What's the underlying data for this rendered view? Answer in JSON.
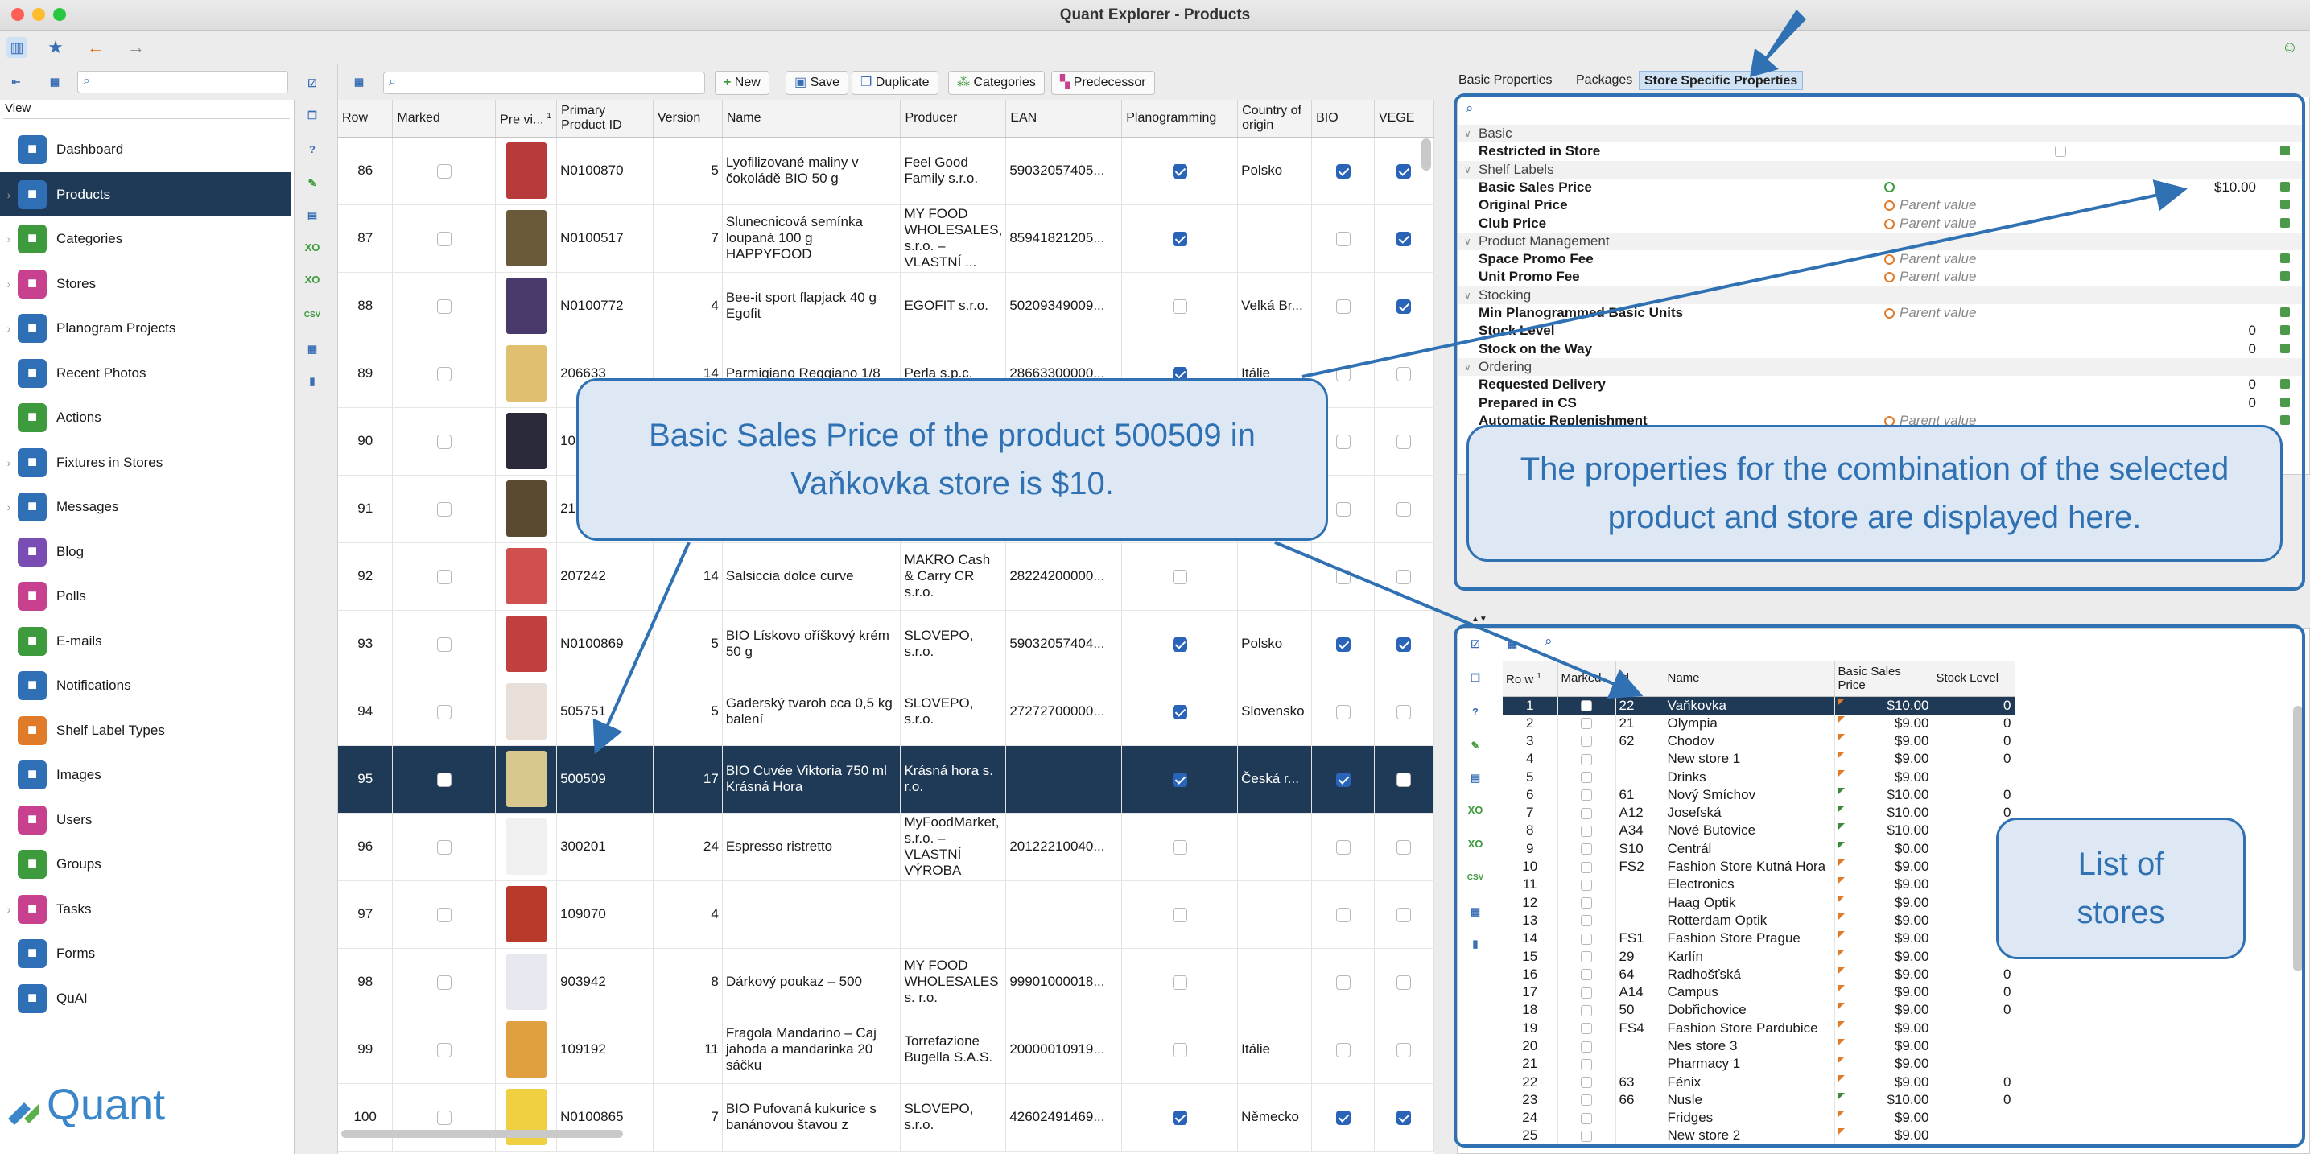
{
  "window": {
    "title": "Quant Explorer - Products"
  },
  "sidebar": {
    "view_label": "View",
    "items": [
      {
        "label": "Dashboard",
        "icon": "dashboard-icon",
        "color": "#2f6fb5",
        "chev": ""
      },
      {
        "label": "Products",
        "icon": "products-icon",
        "color": "#2f6fb5",
        "chev": "›"
      },
      {
        "label": "Categories",
        "icon": "categories-icon",
        "color": "#3d9a3d",
        "chev": "›"
      },
      {
        "label": "Stores",
        "icon": "stores-icon",
        "color": "#c8418e",
        "chev": "›"
      },
      {
        "label": "Planogram Projects",
        "icon": "planogram-icon",
        "color": "#2f6fb5",
        "chev": "›"
      },
      {
        "label": "Recent Photos",
        "icon": "photos-icon",
        "color": "#2f6fb5",
        "chev": ""
      },
      {
        "label": "Actions",
        "icon": "actions-icon",
        "color": "#3d9a3d",
        "chev": ""
      },
      {
        "label": "Fixtures in Stores",
        "icon": "fixtures-icon",
        "color": "#2f6fb5",
        "chev": "›"
      },
      {
        "label": "Messages",
        "icon": "messages-icon",
        "color": "#2f6fb5",
        "chev": "›"
      },
      {
        "label": "Blog",
        "icon": "blog-icon",
        "color": "#7a4db5",
        "chev": ""
      },
      {
        "label": "Polls",
        "icon": "polls-icon",
        "color": "#c8418e",
        "chev": ""
      },
      {
        "label": "E-mails",
        "icon": "emails-icon",
        "color": "#3d9a3d",
        "chev": ""
      },
      {
        "label": "Notifications",
        "icon": "notifications-icon",
        "color": "#2f6fb5",
        "chev": ""
      },
      {
        "label": "Shelf Label Types",
        "icon": "shelf-label-icon",
        "color": "#e07b2a",
        "chev": ""
      },
      {
        "label": "Images",
        "icon": "images-icon",
        "color": "#2f6fb5",
        "chev": ""
      },
      {
        "label": "Users",
        "icon": "users-icon",
        "color": "#c8418e",
        "chev": ""
      },
      {
        "label": "Groups",
        "icon": "groups-icon",
        "color": "#3d9a3d",
        "chev": ""
      },
      {
        "label": "Tasks",
        "icon": "tasks-icon",
        "color": "#c8418e",
        "chev": "›"
      },
      {
        "label": "Forms",
        "icon": "forms-icon",
        "color": "#2f6fb5",
        "chev": ""
      },
      {
        "label": "QuAI",
        "icon": "quai-icon",
        "color": "#2f6fb5",
        "chev": ""
      }
    ],
    "logo_text": "Quant"
  },
  "products": {
    "toolbar": {
      "new": "New",
      "save": "Save",
      "duplicate": "Duplicate",
      "categories": "Categories",
      "predecessor": "Predecessor"
    },
    "columns": [
      "Row",
      "Marked",
      "Pre vi...",
      "Primary Product ID",
      "Version",
      "Name",
      "Producer",
      "EAN",
      "Planogramming",
      "Country of origin",
      "BIO",
      "VEGE"
    ],
    "sort_indicator": "1",
    "rows": [
      {
        "row": "86",
        "marked": false,
        "id": "N0100870",
        "version": "5",
        "name": "Lyofilizované maliny v čokoládě BIO 50 g",
        "producer": "Feel Good Family s.r.o.",
        "ean": "59032057405...",
        "plan": true,
        "country": "Polsko",
        "bio": true,
        "vege": true,
        "thumb": "#b83a3a",
        "sel": false
      },
      {
        "row": "87",
        "marked": false,
        "id": "N0100517",
        "version": "7",
        "name": "Slunecnicová semínka loupaná 100 g HAPPYFOOD",
        "producer": "MY FOOD WHOLESALES, s.r.o. – VLASTNÍ ...",
        "ean": "85941821205...",
        "plan": true,
        "country": "",
        "bio": false,
        "vege": true,
        "thumb": "#6b5a3a",
        "sel": false
      },
      {
        "row": "88",
        "marked": false,
        "id": "N0100772",
        "version": "4",
        "name": "Bee-it sport flapjack 40 g Egofit",
        "producer": "EGOFIT s.r.o.",
        "ean": "50209349009...",
        "plan": false,
        "country": "Velká Br...",
        "bio": false,
        "vege": true,
        "thumb": "#4a3a6b",
        "sel": false
      },
      {
        "row": "89",
        "marked": false,
        "id": "206633",
        "version": "14",
        "name": "Parmigiano Reggiano 1/8",
        "producer": "Perla s.p.c.",
        "ean": "28663300000...",
        "plan": true,
        "country": "Itálie",
        "bio": false,
        "vege": false,
        "thumb": "#e0c070",
        "sel": false
      },
      {
        "row": "90",
        "marked": false,
        "id": "10",
        "version": "",
        "name": "",
        "producer": "",
        "ean": "",
        "plan": false,
        "country": "",
        "bio": false,
        "vege": false,
        "thumb": "#2a2a3a",
        "sel": false
      },
      {
        "row": "91",
        "marked": false,
        "id": "21",
        "version": "",
        "name": "",
        "producer": "",
        "ean": "",
        "plan": false,
        "country": "",
        "bio": false,
        "vege": false,
        "thumb": "#5a4a30",
        "sel": false
      },
      {
        "row": "92",
        "marked": false,
        "id": "207242",
        "version": "14",
        "name": "Salsiccia dolce curve",
        "producer": "MAKRO Cash & Carry CR s.r.o.",
        "ean": "28224200000...",
        "plan": false,
        "country": "",
        "bio": false,
        "vege": false,
        "thumb": "#d05050",
        "sel": false
      },
      {
        "row": "93",
        "marked": false,
        "id": "N0100869",
        "version": "5",
        "name": "BIO Lískovo oříškový krém 50 g",
        "producer": "SLOVEPO, s.r.o.",
        "ean": "59032057404...",
        "plan": true,
        "country": "Polsko",
        "bio": true,
        "vege": true,
        "thumb": "#c04040",
        "sel": false
      },
      {
        "row": "94",
        "marked": false,
        "id": "505751",
        "version": "5",
        "name": "Gaderský tvaroh cca 0,5 kg balení",
        "producer": "SLOVEPO, s.r.o.",
        "ean": "27272700000...",
        "plan": true,
        "country": "Slovensko",
        "bio": false,
        "vege": false,
        "thumb": "#e8e0d8",
        "sel": false
      },
      {
        "row": "95",
        "marked": false,
        "id": "500509",
        "version": "17",
        "name": "BIO Cuvée Viktoria 750 ml Krásná Hora",
        "producer": "Krásná hora s. r.o.",
        "ean": "",
        "plan": true,
        "country": "Česká r...",
        "bio": true,
        "vege": false,
        "thumb": "#d8c890",
        "sel": true
      },
      {
        "row": "96",
        "marked": false,
        "id": "300201",
        "version": "24",
        "name": "Espresso ristretto",
        "producer": "MyFoodMarket, s.r.o. – VLASTNÍ VÝROBA",
        "ean": "20122210040...",
        "plan": false,
        "country": "",
        "bio": false,
        "vege": false,
        "thumb": "#f0f0f0",
        "sel": false
      },
      {
        "row": "97",
        "marked": false,
        "id": "109070",
        "version": "4",
        "name": "",
        "producer": "",
        "ean": "",
        "plan": false,
        "country": "",
        "bio": false,
        "vege": false,
        "thumb": "#b83a2a",
        "sel": false
      },
      {
        "row": "98",
        "marked": false,
        "id": "903942",
        "version": "8",
        "name": "Dárkový poukaz – 500",
        "producer": "MY FOOD WHOLESALES s. r.o.",
        "ean": "99901000018...",
        "plan": false,
        "country": "",
        "bio": false,
        "vege": false,
        "thumb": "#e8e8f0",
        "sel": false
      },
      {
        "row": "99",
        "marked": false,
        "id": "109192",
        "version": "11",
        "name": "Fragola Mandarino – Caj jahoda a mandarinka 20 sáčku",
        "producer": "Torrefazione Bugella S.A.S.",
        "ean": "20000010919...",
        "plan": false,
        "country": "Itálie",
        "bio": false,
        "vege": false,
        "thumb": "#e0a040",
        "sel": false
      },
      {
        "row": "100",
        "marked": false,
        "id": "N0100865",
        "version": "7",
        "name": "BIO Pufovaná kukurice s banánovou štavou z",
        "producer": "SLOVEPO, s.r.o.",
        "ean": "42602491469...",
        "plan": true,
        "country": "Německo",
        "bio": true,
        "vege": true,
        "thumb": "#f0d040",
        "sel": false
      }
    ]
  },
  "right": {
    "tabs": [
      "Basic Properties",
      "Packages",
      "Store Specific Properties"
    ],
    "active_tab": 2,
    "properties": [
      {
        "type": "section",
        "name": "Basic"
      },
      {
        "type": "prop",
        "name": "Restricted in Store",
        "parent": false,
        "value": "",
        "check": true
      },
      {
        "type": "section",
        "name": "Shelf Labels"
      },
      {
        "type": "prop",
        "name": "Basic Sales Price",
        "parent": false,
        "value": "$10.00",
        "edit": true
      },
      {
        "type": "prop",
        "name": "Original Price",
        "parent": true,
        "value": ""
      },
      {
        "type": "prop",
        "name": "Club Price",
        "parent": true,
        "value": ""
      },
      {
        "type": "section",
        "name": "Product Management"
      },
      {
        "type": "prop",
        "name": "Space Promo Fee",
        "parent": true,
        "value": ""
      },
      {
        "type": "prop",
        "name": "Unit Promo Fee",
        "parent": true,
        "value": ""
      },
      {
        "type": "section",
        "name": "Stocking"
      },
      {
        "type": "prop",
        "name": "Min Planogrammed Basic Units",
        "parent": true,
        "value": ""
      },
      {
        "type": "prop",
        "name": "Stock Level",
        "parent": false,
        "value": "0"
      },
      {
        "type": "prop",
        "name": "Stock on the Way",
        "parent": false,
        "value": "0"
      },
      {
        "type": "section",
        "name": "Ordering"
      },
      {
        "type": "prop",
        "name": "Requested Delivery",
        "parent": false,
        "value": "0"
      },
      {
        "type": "prop",
        "name": "Prepared in CS",
        "parent": false,
        "value": "0"
      },
      {
        "type": "prop",
        "name": "Automatic Replenishment",
        "parent": true,
        "value": ""
      }
    ],
    "parent_value_text": "Parent value",
    "store_columns": [
      "Ro w",
      "Marked",
      "Id",
      "Name",
      "Basic Sales Price",
      "Stock Level"
    ],
    "store_sort": "1",
    "stores": [
      {
        "row": "1",
        "id": "22",
        "name": "Vaňkovka",
        "price": "$10.00",
        "stock": "0",
        "flag": "o",
        "sel": true
      },
      {
        "row": "2",
        "id": "21",
        "name": "Olympia",
        "price": "$9.00",
        "stock": "0",
        "flag": "o"
      },
      {
        "row": "3",
        "id": "62",
        "name": "Chodov",
        "price": "$9.00",
        "stock": "0",
        "flag": "o"
      },
      {
        "row": "4",
        "id": "",
        "name": "New store 1",
        "price": "$9.00",
        "stock": "0",
        "flag": "o"
      },
      {
        "row": "5",
        "id": "",
        "name": "Drinks",
        "price": "$9.00",
        "stock": "",
        "flag": "o"
      },
      {
        "row": "6",
        "id": "61",
        "name": "Nový Smíchov",
        "price": "$10.00",
        "stock": "0",
        "flag": "g"
      },
      {
        "row": "7",
        "id": "A12",
        "name": "Josefská",
        "price": "$10.00",
        "stock": "0",
        "flag": "g"
      },
      {
        "row": "8",
        "id": "A34",
        "name": "Nové Butovice",
        "price": "$10.00",
        "stock": "",
        "flag": "g"
      },
      {
        "row": "9",
        "id": "S10",
        "name": "Centrál",
        "price": "$0.00",
        "stock": "",
        "flag": "g"
      },
      {
        "row": "10",
        "id": "FS2",
        "name": "Fashion Store Kutná Hora",
        "price": "$9.00",
        "stock": "",
        "flag": "o"
      },
      {
        "row": "11",
        "id": "",
        "name": "Electronics",
        "price": "$9.00",
        "stock": "",
        "flag": "o"
      },
      {
        "row": "12",
        "id": "",
        "name": "Haag Optik",
        "price": "$9.00",
        "stock": "",
        "flag": "o"
      },
      {
        "row": "13",
        "id": "",
        "name": "Rotterdam Optik",
        "price": "$9.00",
        "stock": "",
        "flag": "o"
      },
      {
        "row": "14",
        "id": "FS1",
        "name": "Fashion Store Prague",
        "price": "$9.00",
        "stock": "",
        "flag": "o"
      },
      {
        "row": "15",
        "id": "29",
        "name": "Karlín",
        "price": "$9.00",
        "stock": "",
        "flag": "o"
      },
      {
        "row": "16",
        "id": "64",
        "name": "Radhošťská",
        "price": "$9.00",
        "stock": "0",
        "flag": "o"
      },
      {
        "row": "17",
        "id": "A14",
        "name": "Campus",
        "price": "$9.00",
        "stock": "0",
        "flag": "o"
      },
      {
        "row": "18",
        "id": "50",
        "name": "Dobřichovice",
        "price": "$9.00",
        "stock": "0",
        "flag": "o"
      },
      {
        "row": "19",
        "id": "FS4",
        "name": "Fashion Store Pardubice",
        "price": "$9.00",
        "stock": "",
        "flag": "o"
      },
      {
        "row": "20",
        "id": "",
        "name": "Nes store 3",
        "price": "$9.00",
        "stock": "",
        "flag": "o"
      },
      {
        "row": "21",
        "id": "",
        "name": "Pharmacy 1",
        "price": "$9.00",
        "stock": "",
        "flag": "o"
      },
      {
        "row": "22",
        "id": "63",
        "name": "Fénix",
        "price": "$9.00",
        "stock": "0",
        "flag": "o"
      },
      {
        "row": "23",
        "id": "66",
        "name": "Nusle",
        "price": "$10.00",
        "stock": "0",
        "flag": "g"
      },
      {
        "row": "24",
        "id": "",
        "name": "Fridges",
        "price": "$9.00",
        "stock": "",
        "flag": "o"
      },
      {
        "row": "25",
        "id": "",
        "name": "New store 2",
        "price": "$9.00",
        "stock": "",
        "flag": "o"
      }
    ]
  },
  "annotations": {
    "callout_price": "Basic Sales Price of the product 500509 in Vaňkovka store is $10.",
    "callout_props": "The properties for the combination of the selected product and store are displayed here.",
    "callout_stores": "List of stores"
  }
}
